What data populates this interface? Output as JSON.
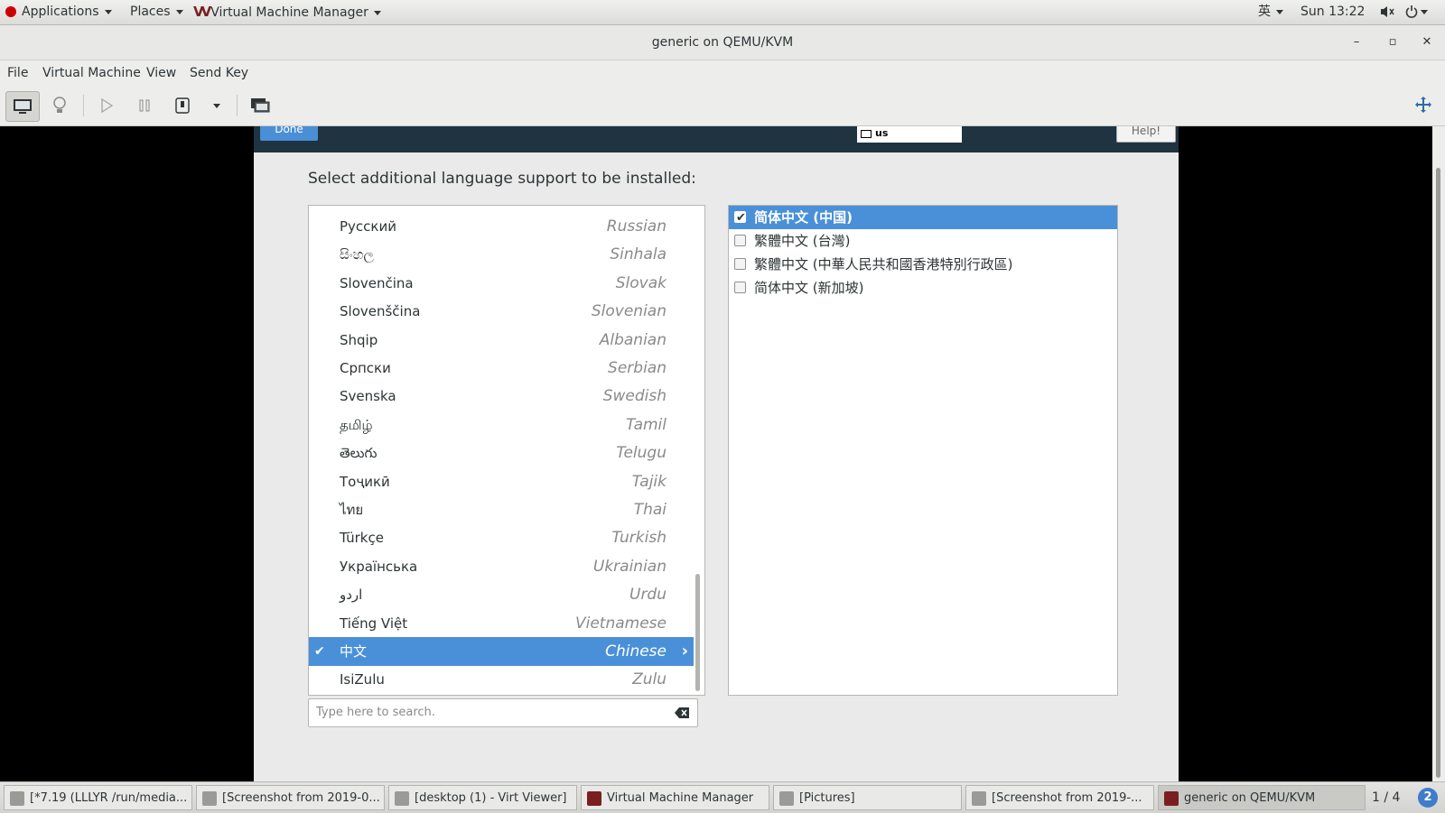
{
  "top_panel": {
    "applications": "Applications",
    "places": "Places",
    "active_app": "Virtual Machine Manager",
    "input_method": "英",
    "clock": "Sun 13:22"
  },
  "window": {
    "title": "generic on QEMU/KVM",
    "menu": [
      "File",
      "Virtual Machine",
      "View",
      "Send Key"
    ]
  },
  "installer": {
    "done_label": "Done",
    "keyboard_layout": "us",
    "help_label": "Help!",
    "instruction": "Select additional language support to be installed:",
    "languages": [
      {
        "native": "Русский",
        "english": "Russian"
      },
      {
        "native": "සිංහල",
        "english": "Sinhala"
      },
      {
        "native": "Slovenčina",
        "english": "Slovak"
      },
      {
        "native": "Slovenščina",
        "english": "Slovenian"
      },
      {
        "native": "Shqip",
        "english": "Albanian"
      },
      {
        "native": "Српски",
        "english": "Serbian"
      },
      {
        "native": "Svenska",
        "english": "Swedish"
      },
      {
        "native": "தமிழ்",
        "english": "Tamil"
      },
      {
        "native": "తెలుగు",
        "english": "Telugu"
      },
      {
        "native": "Тоҷикӣ",
        "english": "Tajik"
      },
      {
        "native": "ไทย",
        "english": "Thai"
      },
      {
        "native": "Türkçe",
        "english": "Turkish"
      },
      {
        "native": "Українська",
        "english": "Ukrainian"
      },
      {
        "native": "اردو",
        "english": "Urdu"
      },
      {
        "native": "Tiếng Việt",
        "english": "Vietnamese"
      },
      {
        "native": "中文",
        "english": "Chinese",
        "selected": true
      },
      {
        "native": "IsiZulu",
        "english": "Zulu"
      }
    ],
    "search_placeholder": "Type here to search.",
    "locales": [
      {
        "label": "简体中文 (中国)",
        "checked": true,
        "selected": true
      },
      {
        "label": "繁體中文 (台灣)",
        "checked": false
      },
      {
        "label": "繁體中文 (中華人民共和國香港特別行政區)",
        "checked": false
      },
      {
        "label": "简体中文 (新加坡)",
        "checked": false
      }
    ]
  },
  "taskbar": {
    "tasks": [
      {
        "label": "[*7.19 (LLLYR /run/media..."
      },
      {
        "label": "[Screenshot from 2019-0..."
      },
      {
        "label": "[desktop (1) - Virt Viewer]"
      },
      {
        "label": "Virtual Machine Manager"
      },
      {
        "label": "[Pictures]"
      },
      {
        "label": "[Screenshot from 2019-..."
      },
      {
        "label": "generic on QEMU/KVM",
        "active": true
      }
    ],
    "workspace": "1 / 4"
  }
}
